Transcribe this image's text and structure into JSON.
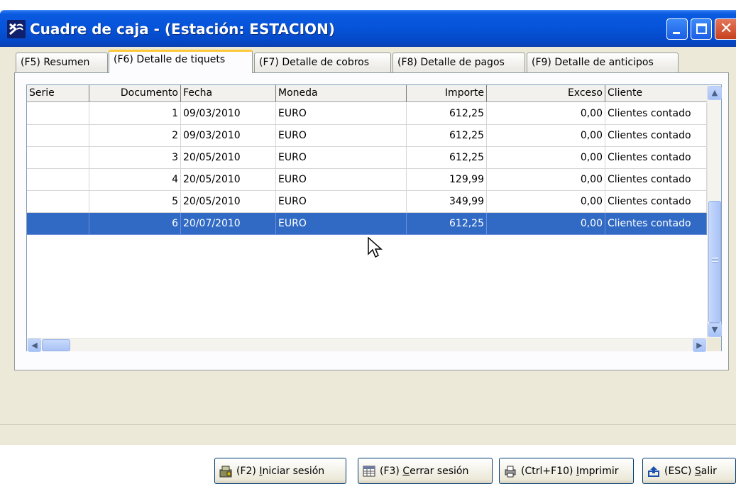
{
  "window": {
    "title": "Cuadre de caja - (Estación: ESTACION)"
  },
  "tabs": [
    {
      "label": "(F5) Resumen",
      "active": false
    },
    {
      "label": "(F6) Detalle de tiquets",
      "active": true
    },
    {
      "label": "(F7) Detalle de cobros",
      "active": false
    },
    {
      "label": "(F8) Detalle de pagos",
      "active": false
    },
    {
      "label": "(F9) Detalle de anticipos",
      "active": false
    }
  ],
  "grid": {
    "columns": [
      "Serie",
      "Documento",
      "Fecha",
      "Moneda",
      "Importe",
      "Exceso",
      "Cliente"
    ],
    "rows": [
      [
        "",
        "1",
        "09/03/2010",
        "EURO",
        "612,25",
        "0,00",
        "Clientes contado"
      ],
      [
        "",
        "2",
        "09/03/2010",
        "EURO",
        "612,25",
        "0,00",
        "Clientes contado"
      ],
      [
        "",
        "3",
        "20/05/2010",
        "EURO",
        "612,25",
        "0,00",
        "Clientes contado"
      ],
      [
        "",
        "4",
        "20/05/2010",
        "EURO",
        "129,99",
        "0,00",
        "Clientes contado"
      ],
      [
        "",
        "5",
        "20/05/2010",
        "EURO",
        "349,99",
        "0,00",
        "Clientes contado"
      ],
      [
        "",
        "6",
        "20/07/2010",
        "EURO",
        "612,25",
        "0,00",
        "Clientes contado"
      ]
    ],
    "selected_row": 5
  },
  "buttons": {
    "start_session": {
      "prefix": "(F2) ",
      "mnemonic": "I",
      "rest": "niciar sesión"
    },
    "close_session": {
      "prefix": "(F3) ",
      "mnemonic": "C",
      "rest": "errar sesión"
    },
    "print": {
      "prefix": "(Ctrl+F10) ",
      "mnemonic": "I",
      "rest": "mprimir"
    },
    "exit": {
      "prefix": "(ESC) ",
      "mnemonic": "S",
      "rest": "alir"
    }
  },
  "colors": {
    "titlebar": "#0653d8",
    "selection": "#316ac5",
    "active_tab_accent": "#ffc83c",
    "window_face": "#ece9d8"
  }
}
